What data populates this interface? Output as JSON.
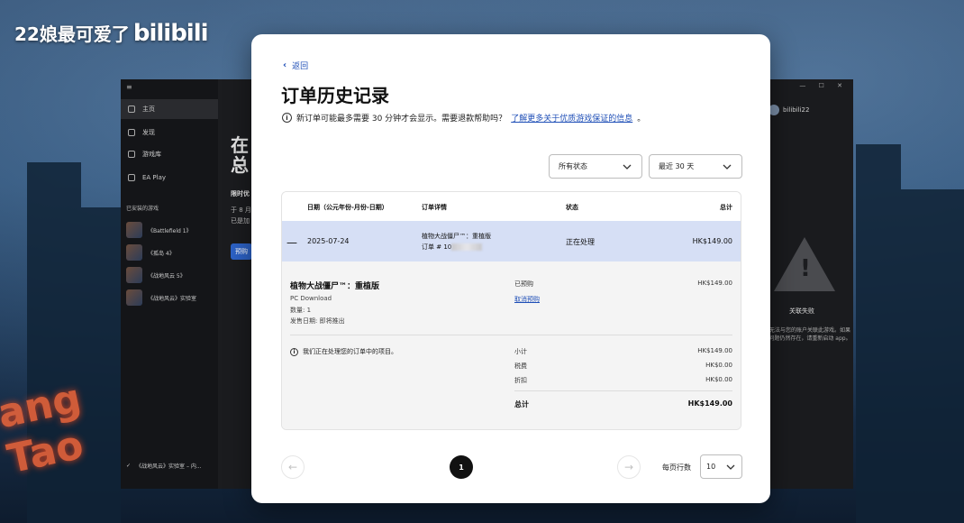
{
  "watermark": {
    "text": "22娘最可爱了",
    "brand": "bilibili"
  },
  "background": {
    "neon_text": "ang Tao"
  },
  "app": {
    "sidebar": {
      "menu_icon": "≡",
      "items": [
        {
          "label": "主页",
          "icon": "home-icon"
        },
        {
          "label": "发现",
          "icon": "discover-icon"
        },
        {
          "label": "游戏库",
          "icon": "library-icon"
        },
        {
          "label": "EA Play",
          "icon": "ea-play-icon"
        }
      ],
      "recent_heading": "已安装的游戏",
      "recent_games": [
        "《Battlefield 1》",
        "《孤岛 4》",
        "《战地风云 5》",
        "《战地风云》实验室"
      ],
      "bottom_status": "《战地风云》实验室 – 内..."
    },
    "main": {
      "headline_line1": "在",
      "headline_line2": "总",
      "limited_text": "限时优",
      "small_line1": "于 8 月",
      "small_line2": "已是加",
      "button_label": "预购"
    },
    "window_controls": "— ☐ ✕",
    "user": {
      "name": "bilibili22"
    },
    "error_panel": {
      "title": "关联失败",
      "body": "无法与您的账户关联此游戏。如果问题仍然存在，请重新启动 app。"
    }
  },
  "modal": {
    "back_label": "返回",
    "title": "订单历史记录",
    "info_text": "新订单可能最多需要 30 分钟才会显示。需要退款帮助吗？",
    "info_link": "了解更多关于优质游戏保证的信息",
    "info_link_suffix": "。",
    "filters": {
      "status": "所有状态",
      "range": "最近 30 天"
    },
    "table": {
      "headers": {
        "date": "日期（公元年份-月份-日期）",
        "details": "订单详情",
        "status": "状态",
        "total": "总计"
      },
      "order": {
        "date": "2025-07-24",
        "product_line": "植物大战僵尸™：重植版",
        "order_prefix": "订单 # 10",
        "status": "正在处理",
        "total": "HK$149.00"
      },
      "detail": {
        "name": "植物大战僵尸™：重植版",
        "platform": "PC Download",
        "quantity": "数量: 1",
        "release": "发售日期: 即将推出",
        "preorder_state": "已预购",
        "cancel_label": "取消预购",
        "price": "HK$149.00",
        "processing_note": "我们正在处理您的订单中的项目。",
        "summary": [
          {
            "label": "小计",
            "value": "HK$149.00"
          },
          {
            "label": "税费",
            "value": "HK$0.00"
          },
          {
            "label": "折扣",
            "value": "HK$0.00"
          }
        ],
        "grand_total_label": "总计",
        "grand_total_value": "HK$149.00"
      }
    },
    "pagination": {
      "current_page": "1",
      "rows_label": "每页行数",
      "rows_value": "10",
      "prev": "←",
      "next": "→"
    }
  },
  "colors": {
    "accent_link": "#1f4fb7",
    "row_highlight": "#d6dff5",
    "detail_bg": "#f4f4f4"
  }
}
